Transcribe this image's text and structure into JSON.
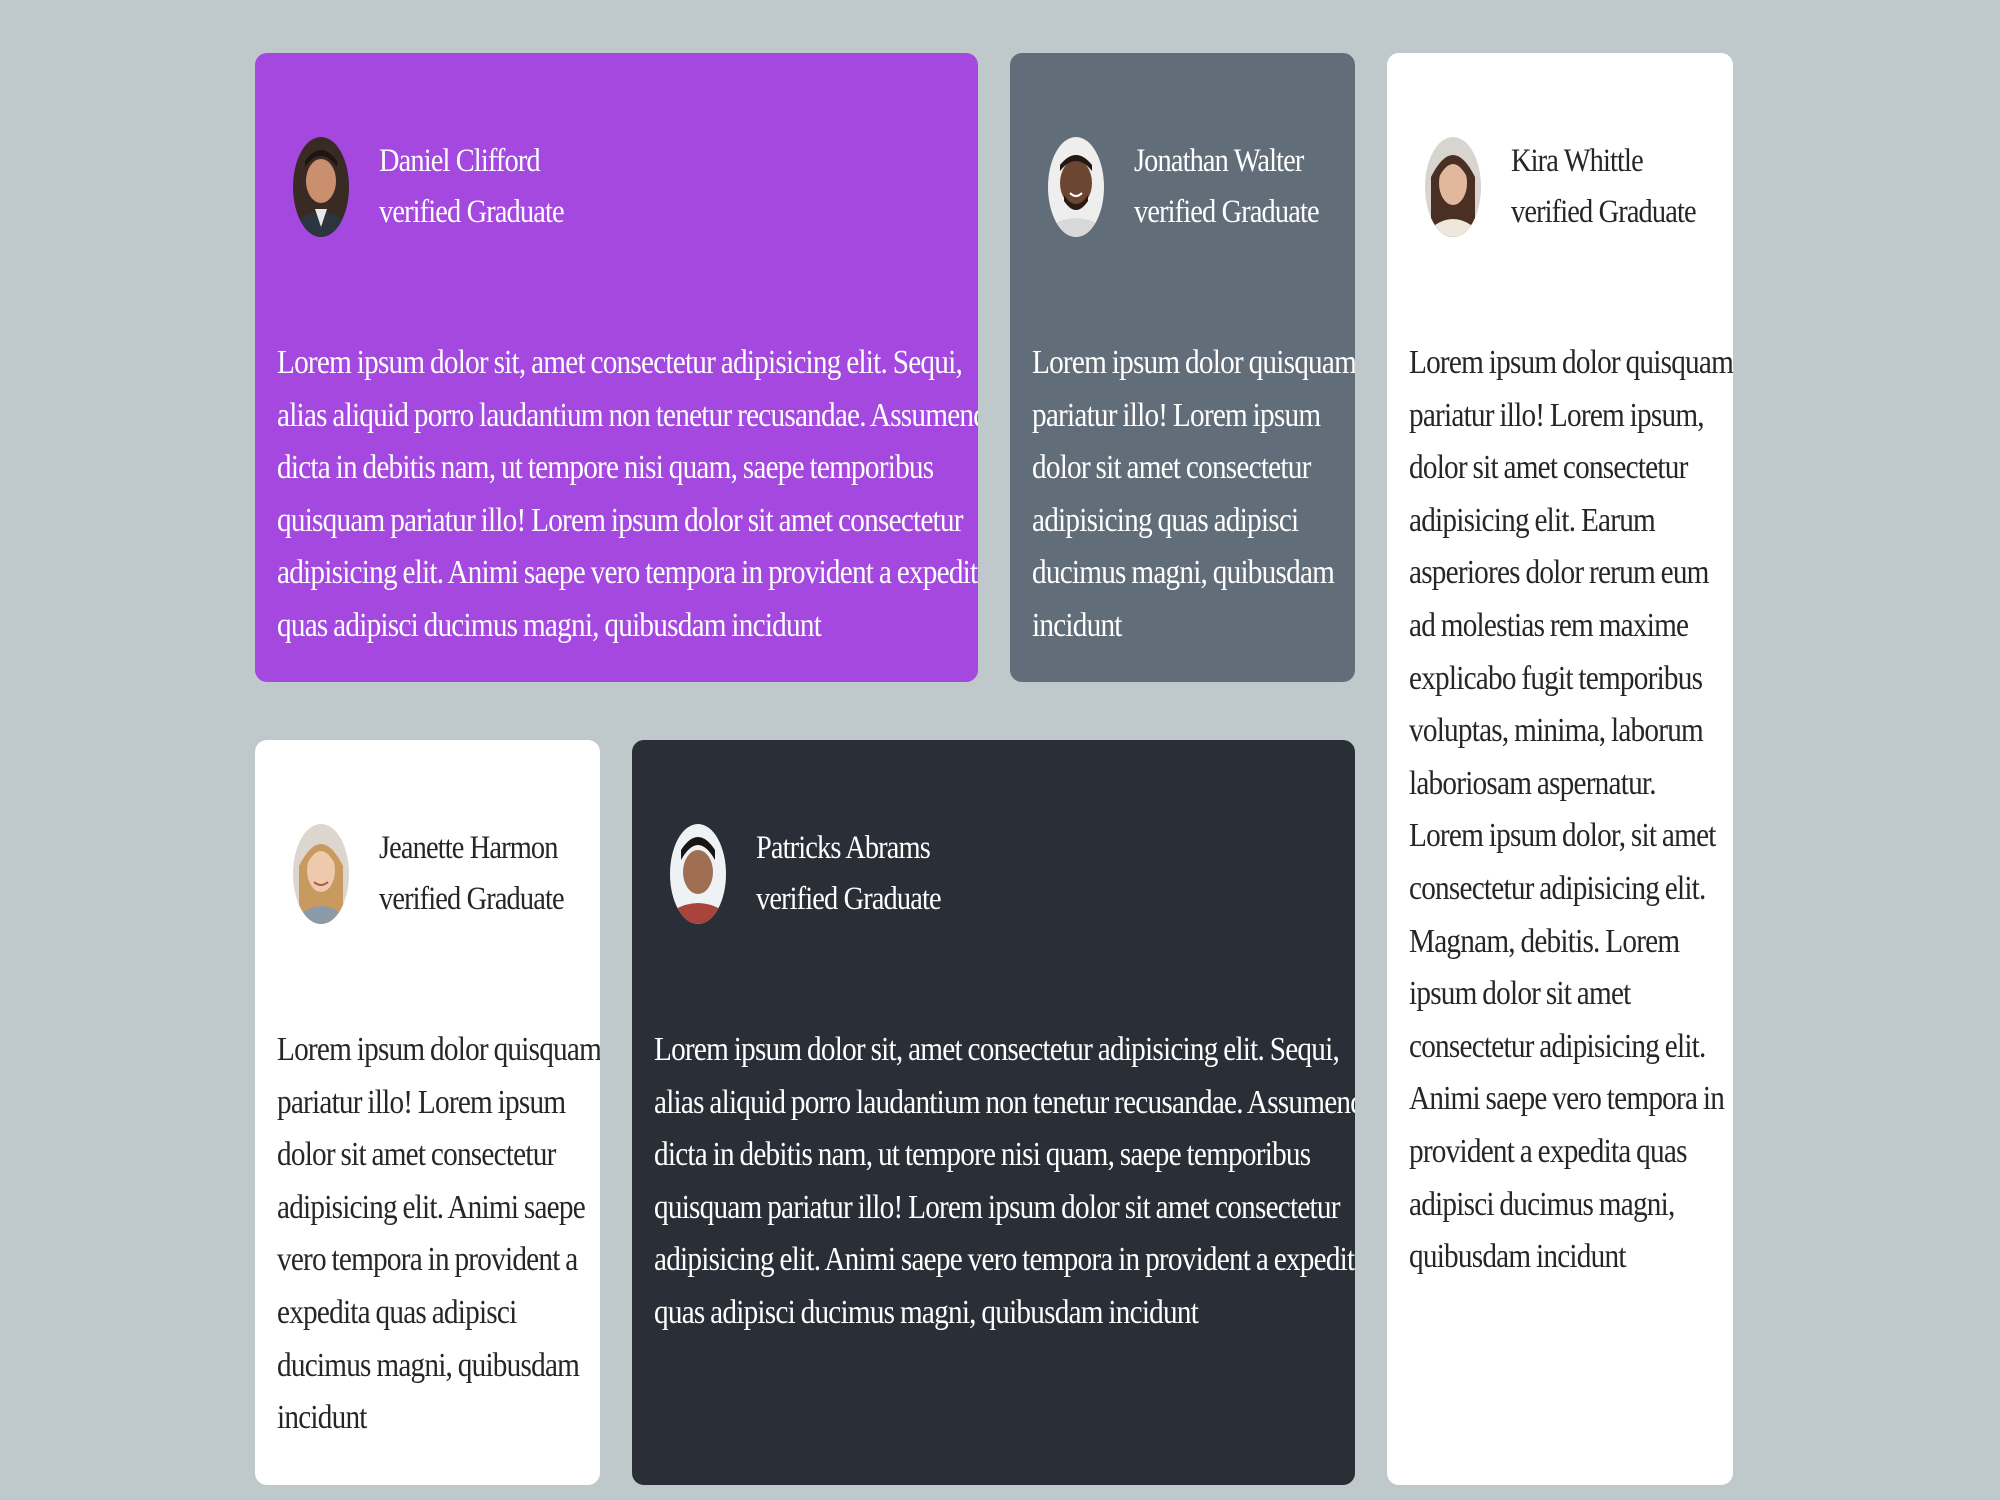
{
  "testimonials": [
    {
      "name": "Daniel Clifford",
      "role": "verified Graduate",
      "avatar_icon": "avatar-daniel-icon",
      "background": "#a448e0",
      "lines": [
        "Lorem ipsum dolor sit, amet consectetur adipisicing elit. Sequi,",
        "alias aliquid porro laudantium non tenetur recusandae. Assumenda",
        "dicta in debitis nam, ut tempore nisi quam, saepe temporibus",
        "quisquam pariatur illo! Lorem ipsum dolor sit amet consectetur",
        "adipisicing elit. Animi saepe vero tempora in provident a expedita",
        "quas adipisci ducimus magni, quibusdam incidunt"
      ]
    },
    {
      "name": "Jonathan Walter",
      "role": "verified Graduate",
      "avatar_icon": "avatar-jonathan-icon",
      "background": "#616e79",
      "lines": [
        "Lorem ipsum dolor quisquam",
        "pariatur illo! Lorem ipsum",
        "dolor sit amet consectetur",
        "adipisicing quas adipisci",
        "ducimus magni, quibusdam",
        "incidunt"
      ]
    },
    {
      "name": "Kira Whittle",
      "role": "verified Graduate",
      "avatar_icon": "avatar-kira-icon",
      "background": "#ffffff",
      "lines": [
        "Lorem ipsum dolor quisquam",
        "pariatur illo! Lorem ipsum,",
        "dolor sit amet consectetur",
        "adipisicing elit. Earum",
        "asperiores dolor rerum eum",
        "ad molestias rem maxime",
        "explicabo fugit temporibus",
        "voluptas, minima, laborum",
        "laboriosam aspernatur.",
        "Lorem ipsum dolor, sit amet",
        "consectetur adipisicing elit.",
        "Magnam, debitis. Lorem",
        "ipsum dolor sit amet",
        "consectetur adipisicing elit.",
        "Animi saepe vero tempora in",
        "provident a expedita quas",
        "adipisci ducimus magni,",
        "quibusdam incidunt"
      ]
    },
    {
      "name": "Jeanette Harmon",
      "role": "verified Graduate",
      "avatar_icon": "avatar-jeanette-icon",
      "background": "#ffffff",
      "lines": [
        "Lorem ipsum dolor quisquam",
        "pariatur illo! Lorem ipsum",
        "dolor sit amet consectetur",
        "adipisicing elit. Animi saepe",
        "vero tempora in provident a",
        "expedita quas adipisci",
        "ducimus magni, quibusdam",
        "incidunt"
      ]
    },
    {
      "name": "Patricks Abrams",
      "role": "verified Graduate",
      "avatar_icon": "avatar-patrick-icon",
      "background": "#2a2e36",
      "lines": [
        "Lorem ipsum dolor sit, amet consectetur adipisicing elit. Sequi,",
        "alias aliquid porro laudantium non tenetur recusandae. Assumenda",
        "dicta in debitis nam, ut tempore nisi quam, saepe temporibus",
        "quisquam pariatur illo! Lorem ipsum dolor sit amet consectetur",
        "adipisicing elit. Animi saepe vero tempora in provident a expedita",
        "quas adipisci ducimus magni, quibusdam incidunt"
      ]
    }
  ]
}
